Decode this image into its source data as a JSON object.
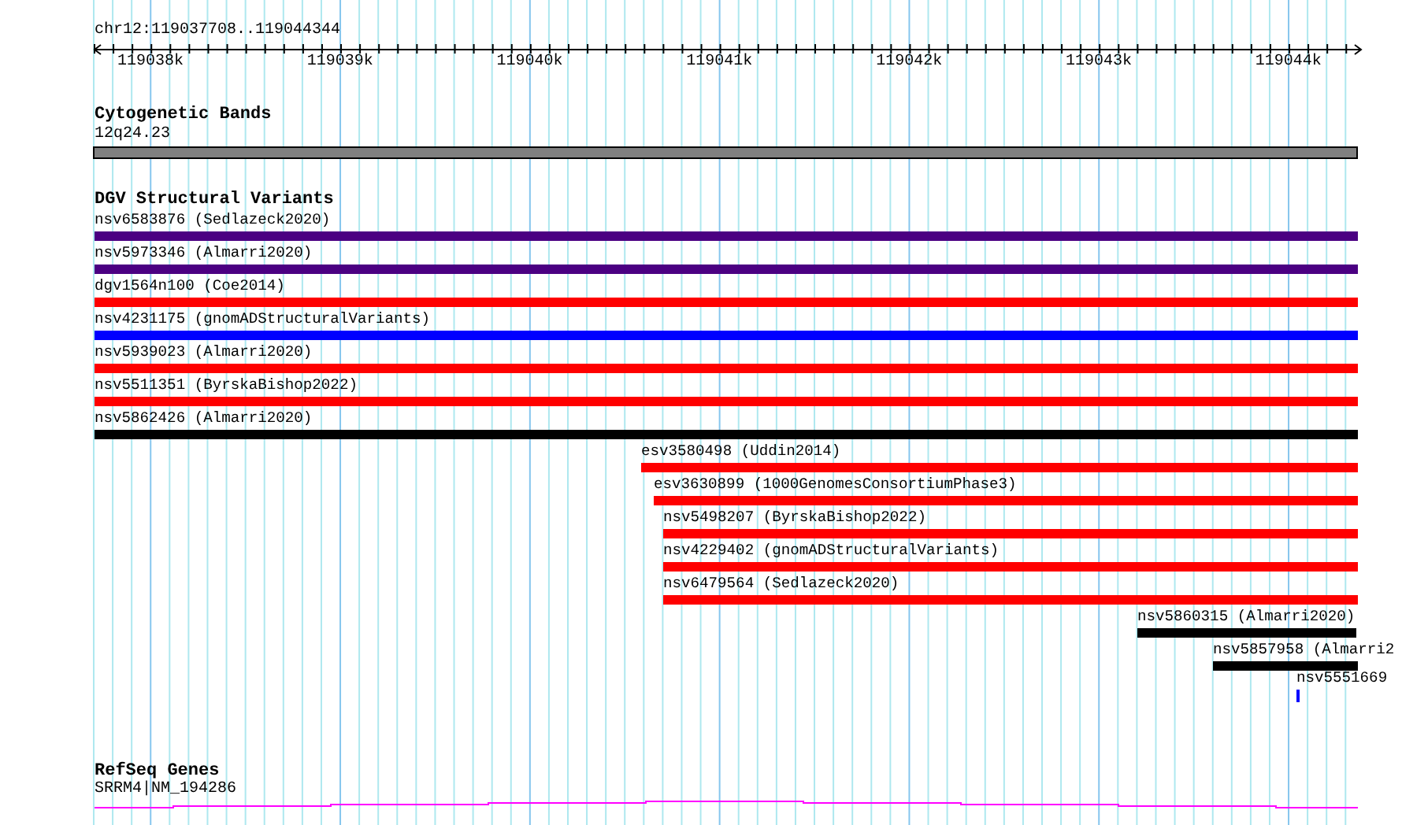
{
  "ruler": {
    "location": "chr12:119037708..119044344",
    "ticks": [
      "119038k",
      "119039k",
      "119040k",
      "119041k",
      "119042k",
      "119043k",
      "119044k"
    ]
  },
  "cytogenetic_bands": {
    "title": "Cytogenetic Bands",
    "features": [
      {
        "label": "12q24.23",
        "color": "#808080"
      }
    ]
  },
  "dgv_structural_variants": {
    "title": "DGV Structural Variants",
    "features": [
      {
        "label": "nsv6583876 (Sedlazeck2020)",
        "color": "#4b0082"
      },
      {
        "label": "nsv5973346 (Almarri2020)",
        "color": "#4b0082"
      },
      {
        "label": "dgv1564n100 (Coe2014)",
        "color": "#ff0000"
      },
      {
        "label": "nsv4231175 (gnomADStructuralVariants)",
        "color": "#0000ff"
      },
      {
        "label": "nsv5939023 (Almarri2020)",
        "color": "#ff0000"
      },
      {
        "label": "nsv5511351 (ByrskaBishop2022)",
        "color": "#ff0000"
      },
      {
        "label": "nsv5862426 (Almarri2020)",
        "color": "#000000"
      },
      {
        "label": "esv3580498 (Uddin2014)",
        "color": "#ff0000"
      },
      {
        "label": "esv3630899 (1000GenomesConsortiumPhase3)",
        "color": "#ff0000"
      },
      {
        "label": "nsv5498207 (ByrskaBishop2022)",
        "color": "#ff0000"
      },
      {
        "label": "nsv4229402 (gnomADStructuralVariants)",
        "color": "#ff0000"
      },
      {
        "label": "nsv6479564 (Sedlazeck2020)",
        "color": "#ff0000"
      },
      {
        "label": "nsv5860315 (Almarri2020)",
        "color": "#000000"
      },
      {
        "label": "nsv5857958 (Almarri2",
        "color": "#000000"
      },
      {
        "label": "nsv5551669",
        "color": "#0000ff"
      }
    ]
  },
  "refseq_genes": {
    "title": "RefSeq Genes",
    "features": [
      {
        "label": "SRRM4|NM_194286",
        "color": "#ff00ff"
      }
    ]
  }
}
